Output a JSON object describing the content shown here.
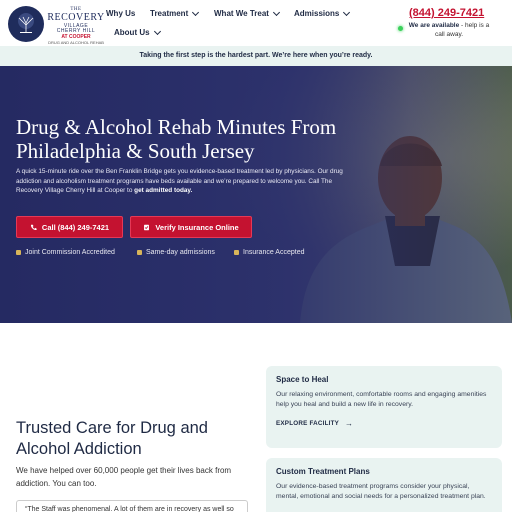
{
  "logo": {
    "line1": "THE",
    "line2": "RECOVERY",
    "line3": "VILLAGE",
    "line4": "CHERRY HILL",
    "line5": "AT COOPER",
    "line6": "DRUG AND ALCOHOL REHAB"
  },
  "nav": {
    "items": [
      {
        "label": "Why Us"
      },
      {
        "label": "Treatment"
      },
      {
        "label": "What We Treat"
      },
      {
        "label": "Admissions"
      },
      {
        "label": "About Us"
      }
    ]
  },
  "contact": {
    "phone": "(844) 249-7421",
    "availability_bold": "We are available",
    "availability_rest": " - help is a call away."
  },
  "banner": {
    "text": "Taking the first step is the hardest part. We’re here when you’re ready."
  },
  "hero": {
    "title": "Drug & Alcohol Rehab Minutes From Philadelphia & South Jersey",
    "body": "A quick 15-minute ride over the Ben Franklin Bridge gets you evidence-based treatment led by physicians. Our drug addiction and alcoholism treatment programs have beds available and we’re prepared to welcome you. Call The Recovery Village Cherry Hill at Cooper to ",
    "body_bold": "get admitted today.",
    "call_button": "Call (844) 249-7421",
    "verify_button": "Verify Insurance Online",
    "badges": [
      {
        "label": "Joint Commission Accredited"
      },
      {
        "label": "Same-day admissions"
      },
      {
        "label": "Insurance Accepted"
      }
    ]
  },
  "section": {
    "title": "Trusted Care for Drug and Alcohol Addiction",
    "body": "We have helped over 60,000 people get their lives back from addiction. You can too.",
    "quote": "“The Staff was phenomenal. A lot of them are in recovery as well so"
  },
  "cards": [
    {
      "title": "Space to Heal",
      "body": "Our relaxing environment, comfortable rooms and engaging amenities help you heal and build a new life in recovery.",
      "link": "EXPLORE FACILITY"
    },
    {
      "title": "Custom Treatment Plans",
      "body": "Our evidence-based treatment programs consider your physical, mental, emotional and social needs for a personalized treatment plan."
    }
  ],
  "colors": {
    "navy": "#1f2c5c",
    "accent_red": "#c41230",
    "mint": "#e9f3f1",
    "status_green": "#3bd15b"
  }
}
